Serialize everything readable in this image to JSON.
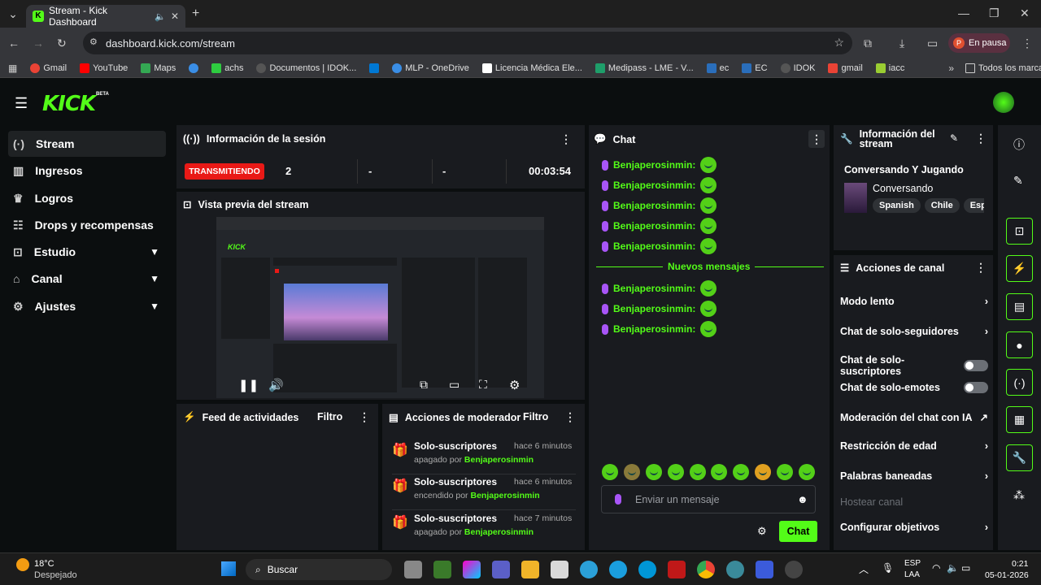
{
  "browser": {
    "tab_title": "Stream - Kick Dashboard",
    "url": "dashboard.kick.com/stream",
    "profile_label": "En pausa",
    "profile_initial": "P",
    "bookmarks": [
      "Gmail",
      "YouTube",
      "Maps",
      "",
      "achs",
      "Documentos | IDOK...",
      "",
      "MLP - OneDrive",
      "Licencia Médica Ele...",
      "Medipass - LME - V...",
      "ec",
      "EC",
      "IDOK",
      "gmail",
      "iacc"
    ],
    "all_bookmarks": "Todos los marcadores"
  },
  "app": {
    "logo": "KICK",
    "beta": "BETA",
    "nav": [
      {
        "label": "Stream",
        "icon": "broadcast-icon"
      },
      {
        "label": "Ingresos",
        "icon": "chart-icon"
      },
      {
        "label": "Logros",
        "icon": "trophy-icon"
      },
      {
        "label": "Drops y recompensas",
        "icon": "drops-icon"
      },
      {
        "label": "Estudio",
        "icon": "studio-icon"
      },
      {
        "label": "Canal",
        "icon": "channel-icon"
      },
      {
        "label": "Ajustes",
        "icon": "gear-icon"
      }
    ],
    "session": {
      "title": "Información de la sesión",
      "status": "TRANSMITIENDO",
      "viewers": "2",
      "stat2": "-",
      "stat3": "-",
      "duration": "00:03:54"
    },
    "preview": {
      "title": "Vista previa del stream"
    },
    "feed": {
      "title": "Feed de actividades",
      "filter": "Filtro"
    },
    "mod": {
      "title": "Acciones de moderador",
      "filter": "Filtro",
      "items": [
        {
          "title": "Solo-suscriptores",
          "time": "hace 6 minutos",
          "action": "apagado por",
          "user": "Benjaperosinmin"
        },
        {
          "title": "Solo-suscriptores",
          "time": "hace 6 minutos",
          "action": "encendido por",
          "user": "Benjaperosinmin"
        },
        {
          "title": "Solo-suscriptores",
          "time": "hace 7 minutos",
          "action": "apagado por",
          "user": "Benjaperosinmin"
        }
      ]
    },
    "chat": {
      "title": "Chat",
      "messages_top": [
        "Benjaperosinmin:",
        "Benjaperosinmin:",
        "Benjaperosinmin:",
        "Benjaperosinmin:",
        "Benjaperosinmin:"
      ],
      "new_label": "Nuevos mensajes",
      "messages_bottom": [
        "Benjaperosinmin:",
        "Benjaperosinmin:",
        "Benjaperosinmin:"
      ],
      "placeholder": "Enviar un mensaje",
      "send": "Chat"
    },
    "stream_info": {
      "title": "Información del stream",
      "stream_title": "Conversando Y Jugando",
      "category": "Conversando",
      "tags": [
        "Spanish",
        "Chile",
        "Espar"
      ]
    },
    "channel_actions": {
      "title": "Acciones de canal",
      "items": [
        {
          "label": "Modo lento",
          "control": "chevron"
        },
        {
          "label": "Chat de solo-seguidores",
          "control": "chevron"
        },
        {
          "label": "Chat de solo-suscriptores",
          "control": "toggle"
        },
        {
          "label": "Chat de solo-emotes",
          "control": "toggle"
        },
        {
          "label": "Moderación del chat con IA",
          "control": "external"
        },
        {
          "label": "Restricción de edad",
          "control": "chevron"
        },
        {
          "label": "Palabras baneadas",
          "control": "chevron"
        },
        {
          "label": "Hostear canal",
          "control": "none"
        },
        {
          "label": "Configurar objetivos",
          "control": "chevron"
        }
      ]
    }
  },
  "taskbar": {
    "weather_temp": "18°C",
    "weather_desc": "Despejado",
    "search": "Buscar",
    "lang1": "ESP",
    "lang2": "LAA",
    "time": "0:21",
    "date": "05-01-2026"
  },
  "colors": {
    "accent": "#53fc18",
    "live": "#e91916",
    "panel": "#191b1f"
  }
}
